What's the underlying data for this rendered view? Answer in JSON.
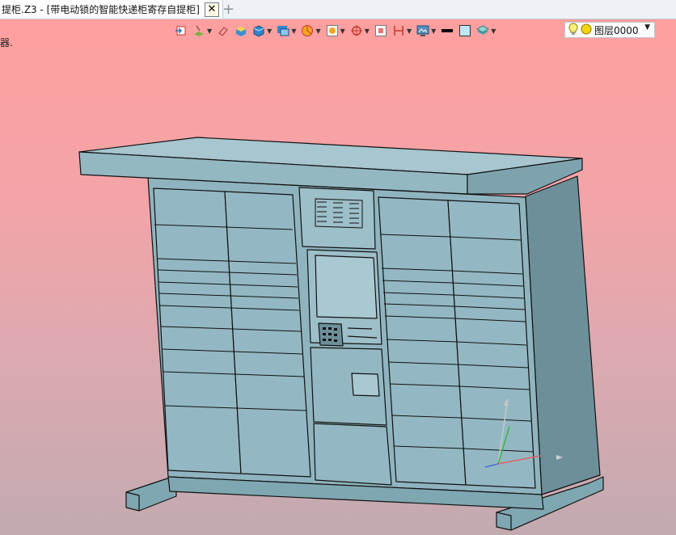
{
  "tab": {
    "title": "提柜.Z3 - [带电动锁的智能快递柜寄存自提柜]",
    "close_glyph": "✕",
    "add_glyph": "+"
  },
  "status": {
    "text": "器."
  },
  "toolbar": {
    "icons": [
      "import-icon",
      "layer-brush-icon",
      "eraser-icon",
      "box-color-icon",
      "cube-icon",
      "view-icon",
      "pie-icon",
      "frame-icon",
      "crosshair-icon",
      "grid-icon",
      "dimension-icon",
      "display-icon",
      "line-color-icon",
      "fill-color-icon",
      "layers-icon"
    ]
  },
  "layer": {
    "name": "图层0000",
    "bulb_color": "#f5d400"
  },
  "colors": {
    "cabinet": "#8fb4bf",
    "cabinet_dark": "#6d8f9a",
    "cabinet_top": "#a3c3cc",
    "outline": "#111111"
  }
}
